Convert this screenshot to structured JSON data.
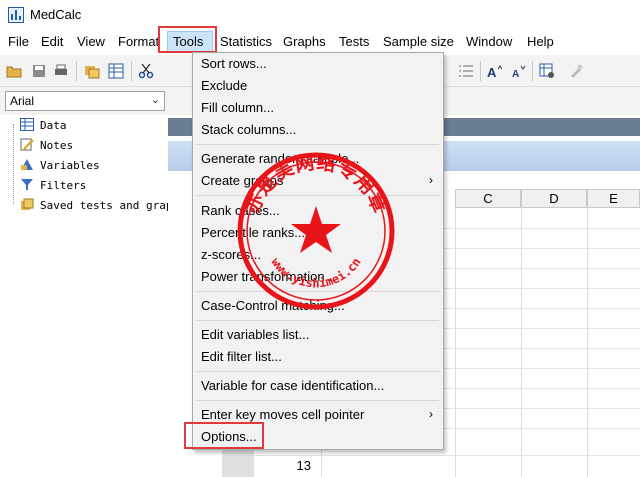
{
  "window": {
    "title": "MedCalc"
  },
  "menubar": {
    "items": [
      "File",
      "Edit",
      "View",
      "Format",
      "Tools",
      "Statistics",
      "Graphs",
      "Tests",
      "Sample size",
      "Window",
      "Help"
    ]
  },
  "fontbar": {
    "font_value": "Arial"
  },
  "tree": {
    "items": [
      "Data",
      "Notes",
      "Variables",
      "Filters",
      "Saved tests and graphs"
    ]
  },
  "sheet": {
    "columns": [
      "C",
      "D",
      "E"
    ],
    "visible_row_number": "13"
  },
  "tools_menu": {
    "items": [
      "Sort rows...",
      "Exclude",
      "Fill column...",
      "Stack columns...",
      "Generate random sample...",
      "Create groups",
      "Rank cases...",
      "Percentile ranks...",
      "z-scores...",
      "Power transformation...",
      "Case-Control matching...",
      "Edit variables list...",
      "Edit filter list...",
      "Variable for case identification...",
      "Enter key moves cell pointer",
      "Options..."
    ],
    "submenu_arrow": "›"
  },
  "watermark": {
    "text": "亦是美网络专用章",
    "url": "www.yishimei.cn",
    "color": "#e8141a"
  },
  "colors": {
    "highlight": "#e03a3a",
    "menu_hover": "#cce4f7"
  }
}
